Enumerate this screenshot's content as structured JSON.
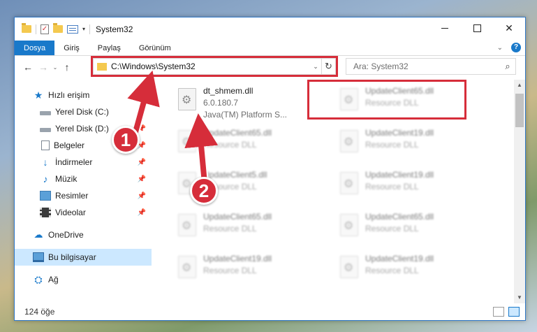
{
  "window": {
    "title": "System32"
  },
  "ribbon": {
    "tabs": [
      {
        "label": "Dosya",
        "active": true
      },
      {
        "label": "Giriş",
        "active": false
      },
      {
        "label": "Paylaş",
        "active": false
      },
      {
        "label": "Görünüm",
        "active": false
      }
    ]
  },
  "navbar": {
    "back_icon": "arrow-left-icon",
    "forward_icon": "arrow-right-icon",
    "up_icon": "arrow-up-icon",
    "address": "C:\\Windows\\System32",
    "search_placeholder": "Ara: System32"
  },
  "sidebar": {
    "items": [
      {
        "label": "Hızlı erişim",
        "icon": "star-icon",
        "pinned": false
      },
      {
        "label": "Yerel Disk (C:)",
        "icon": "disk-icon",
        "pinned": true
      },
      {
        "label": "Yerel Disk (D:)",
        "icon": "disk-icon",
        "pinned": true
      },
      {
        "label": "Belgeler",
        "icon": "document-icon",
        "pinned": true
      },
      {
        "label": "İndirmeler",
        "icon": "download-icon",
        "pinned": true
      },
      {
        "label": "Müzik",
        "icon": "music-icon",
        "pinned": true
      },
      {
        "label": "Resimler",
        "icon": "pictures-icon",
        "pinned": true
      },
      {
        "label": "Videolar",
        "icon": "video-icon",
        "pinned": true
      },
      {
        "label": "OneDrive",
        "icon": "cloud-icon",
        "pinned": false
      },
      {
        "label": "Bu bilgisayar",
        "icon": "computer-icon",
        "pinned": false,
        "selected": true
      },
      {
        "label": "Ağ",
        "icon": "network-icon",
        "pinned": false
      }
    ]
  },
  "files": [
    {
      "name": "dt_shmem.dll",
      "line2": "6.0.180.7",
      "line3": "Java(TM) Platform S...",
      "highlighted": true
    },
    {
      "name": "UpdateClient65.dll",
      "line2": "Resource DLL"
    },
    {
      "name": "UpdateClient65.dll",
      "line2": "Resource DLL"
    },
    {
      "name": "UpdateClient19.dll",
      "line2": "Resource DLL"
    },
    {
      "name": "UpdateClient5.dll",
      "line2": "Resource DLL"
    },
    {
      "name": "UpdateClient19.dll",
      "line2": "Resource DLL"
    },
    {
      "name": "UpdateClient65.dll",
      "line2": "Resource DLL"
    },
    {
      "name": "UpdateClient65.dll",
      "line2": "Resource DLL"
    },
    {
      "name": "UpdateClient19.dll",
      "line2": "Resource DLL"
    },
    {
      "name": "UpdateClient19.dll",
      "line2": "Resource DLL"
    }
  ],
  "status": {
    "count": "124 öğe"
  },
  "markers": [
    "1",
    "2"
  ],
  "colors": {
    "accent": "#1979ca",
    "highlight": "#d62d3a",
    "selected_bg": "#cce8ff"
  }
}
